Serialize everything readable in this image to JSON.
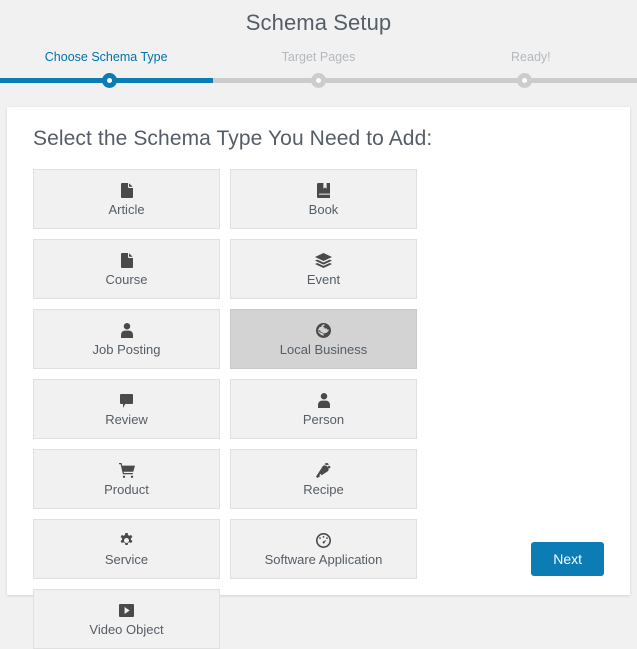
{
  "header": {
    "title": "Schema Setup"
  },
  "steps": {
    "progress_percent": 33,
    "active_color": "#0c7cb5",
    "inactive_color": "#cccccc",
    "items": [
      {
        "label": "Choose Schema Type",
        "state": "active"
      },
      {
        "label": "Target Pages",
        "state": "inactive"
      },
      {
        "label": "Ready!",
        "state": "inactive"
      }
    ]
  },
  "panel": {
    "heading": "Select the Schema Type You Need to Add:",
    "selected_type": "Local Business",
    "types": [
      {
        "label": "Article",
        "icon": "file-icon",
        "selected": false
      },
      {
        "label": "Book",
        "icon": "book-icon",
        "selected": false
      },
      {
        "label": "Course",
        "icon": "file-icon",
        "selected": false
      },
      {
        "label": "Event",
        "icon": "layers-icon",
        "selected": false
      },
      {
        "label": "Job Posting",
        "icon": "user-icon",
        "selected": false
      },
      {
        "label": "Local Business",
        "icon": "globe-icon",
        "selected": true
      },
      {
        "label": "Review",
        "icon": "comment-icon",
        "selected": false
      },
      {
        "label": "Person",
        "icon": "user-icon",
        "selected": false
      },
      {
        "label": "Product",
        "icon": "shopping-cart-icon",
        "selected": false
      },
      {
        "label": "Recipe",
        "icon": "carrot-icon",
        "selected": false
      },
      {
        "label": "Service",
        "icon": "gear-icon",
        "selected": false
      },
      {
        "label": "Software Application",
        "icon": "dashboard-icon",
        "selected": false
      },
      {
        "label": "Video Object",
        "icon": "play-icon",
        "selected": false
      }
    ]
  },
  "footer": {
    "next_label": "Next",
    "next_color": "#0c7cb5"
  }
}
